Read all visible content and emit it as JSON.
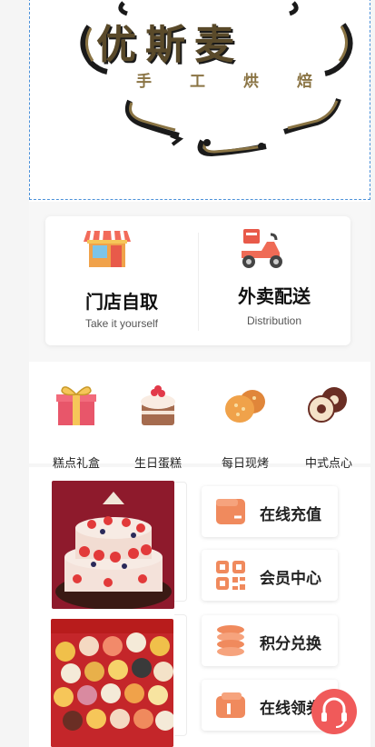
{
  "brand": {
    "name": "优斯麦",
    "tagline": "手工烘焙"
  },
  "order_options": [
    {
      "title": "门店自取",
      "subtitle": "Take it yourself",
      "icon": "storefront-icon"
    },
    {
      "title": "外卖配送",
      "subtitle": "Distribution",
      "icon": "delivery-scooter-icon"
    }
  ],
  "categories": [
    {
      "label": "糕点礼盒",
      "icon": "gift-box-icon"
    },
    {
      "label": "生日蛋糕",
      "icon": "birthday-cake-icon"
    },
    {
      "label": "每日现烤",
      "icon": "bread-icon"
    },
    {
      "label": "中式点心",
      "icon": "mooncake-icon"
    }
  ],
  "services": [
    {
      "label": "在线充值",
      "icon": "wallet-icon"
    },
    {
      "label": "会员中心",
      "icon": "qr-code-icon"
    },
    {
      "label": "积分兑换",
      "icon": "coin-stack-icon"
    },
    {
      "label": "在线领券",
      "icon": "coupon-wallet-icon"
    }
  ],
  "colors": {
    "accent": "#f08a5d",
    "support": "#f05a5a",
    "logo": "#5a4a2a"
  }
}
